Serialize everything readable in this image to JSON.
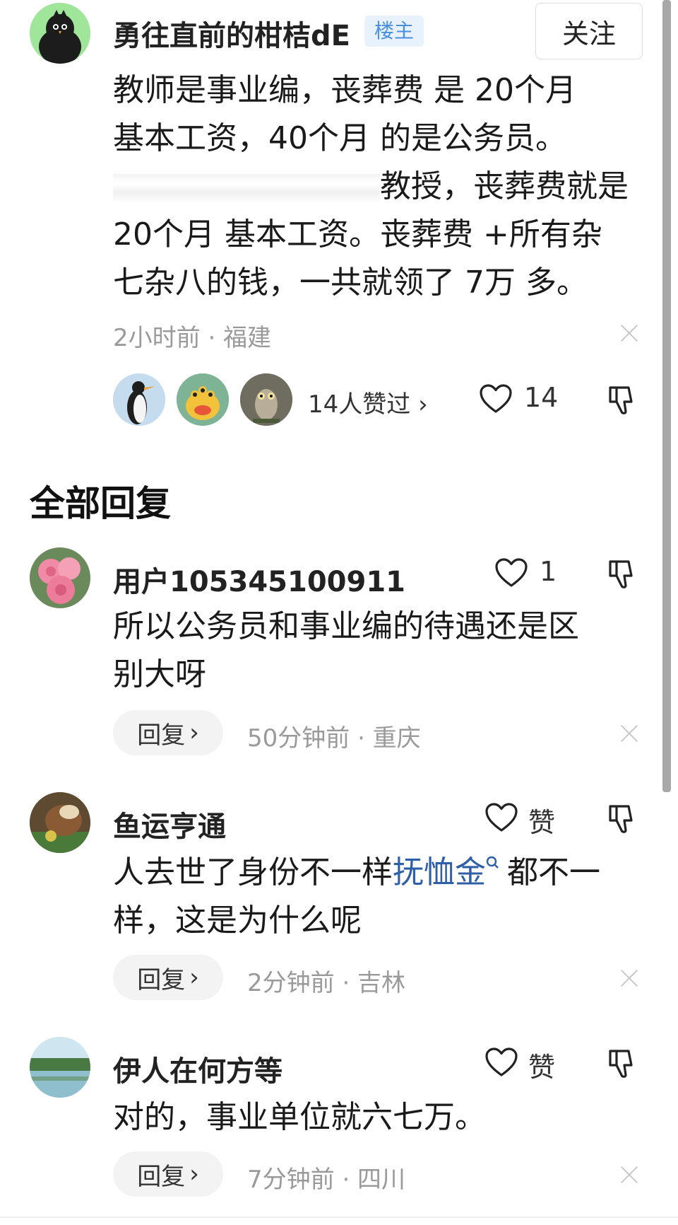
{
  "post": {
    "username": "勇往直前的柑桔dE",
    "op_badge": "楼主",
    "follow_label": "关注",
    "lines": [
      "教师是事业编，丧葬费 是 20个月",
      "基本工资，40个月 的是公务员。",
      "教授，丧葬费就是",
      "20个月 基本工资。丧葬费 +所有杂",
      "七杂八的钱，一共就领了 7万 多。"
    ],
    "meta": "2小时前 · 福建",
    "likers_text": "14人赞过 ›",
    "like_count": "14"
  },
  "section_title": "全部回复",
  "replies": [
    {
      "username": "用户105345100911",
      "like_label": "1",
      "lines": [
        "所以公务员和事业编的待遇还是区",
        "别大呀"
      ],
      "reply_label": "回复",
      "meta": "50分钟前 · 重庆"
    },
    {
      "username": "鱼运亨通",
      "like_label": "赞",
      "line1_before": "人去世了身份不一样",
      "line1_link": "抚恤金",
      "line1_after": "都不一",
      "line2": "样，这是为什么呢",
      "reply_label": "回复",
      "meta": "2分钟前 · 吉林"
    },
    {
      "username": "伊人在何方等",
      "like_label": "赞",
      "lines": [
        "对的，事业单位就六七万。"
      ],
      "reply_label": "回复",
      "meta": "7分钟前 · 四川"
    }
  ],
  "colors": {
    "badge_bg": "#e8f2fc",
    "badge_text": "#4a8fe0",
    "link": "#2f5fa7",
    "meta": "#9a9a9a"
  }
}
